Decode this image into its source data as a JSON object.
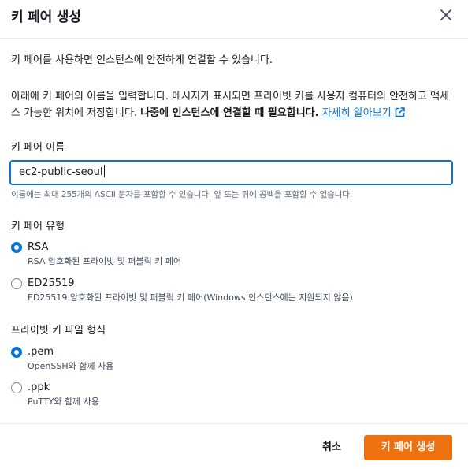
{
  "dialog": {
    "title": "키 페어 생성",
    "close_icon": "close-icon"
  },
  "intro": "키 페어를 사용하면 인스턴스에 안전하게 연결할 수 있습니다.",
  "description": {
    "text": "아래에 키 페어의 이름을 입력합니다. 메시지가 표시되면 프라이빗 키를 사용자 컴퓨터의 안전하고 액세스 가능한 위치에 저장합니다.",
    "bold": "나중에 인스턴스에 연결할 때 필요합니다.",
    "link": "자세히 알아보기",
    "link_icon": "external-link-icon"
  },
  "key_name": {
    "label": "키 페어 이름",
    "value": "ec2-public-seoul",
    "hint": "이름에는 최대 255개의 ASCII 문자를 포함할 수 있습니다. 앞 또는 뒤에 공백을 포함할 수 없습니다."
  },
  "key_type": {
    "label": "키 페어 유형",
    "options": [
      {
        "label": "RSA",
        "description": "RSA 암호화된 프라이빗 및 퍼블릭 키 페어",
        "selected": true
      },
      {
        "label": "ED25519",
        "description": "ED25519 암호화된 프라이빗 및 퍼블릭 키 페어(Windows 인스턴스에는 지원되지 않음)",
        "selected": false
      }
    ]
  },
  "file_format": {
    "label": "프라이빗 키 파일 형식",
    "options": [
      {
        "label": ".pem",
        "description": "OpenSSH와 함께 사용",
        "selected": true
      },
      {
        "label": ".ppk",
        "description": "PuTTY와 함께 사용",
        "selected": false
      }
    ]
  },
  "footer": {
    "cancel_label": "취소",
    "submit_label": "키 페어 생성"
  },
  "colors": {
    "accent": "#0972d3",
    "primary_button": "#ec7211"
  }
}
